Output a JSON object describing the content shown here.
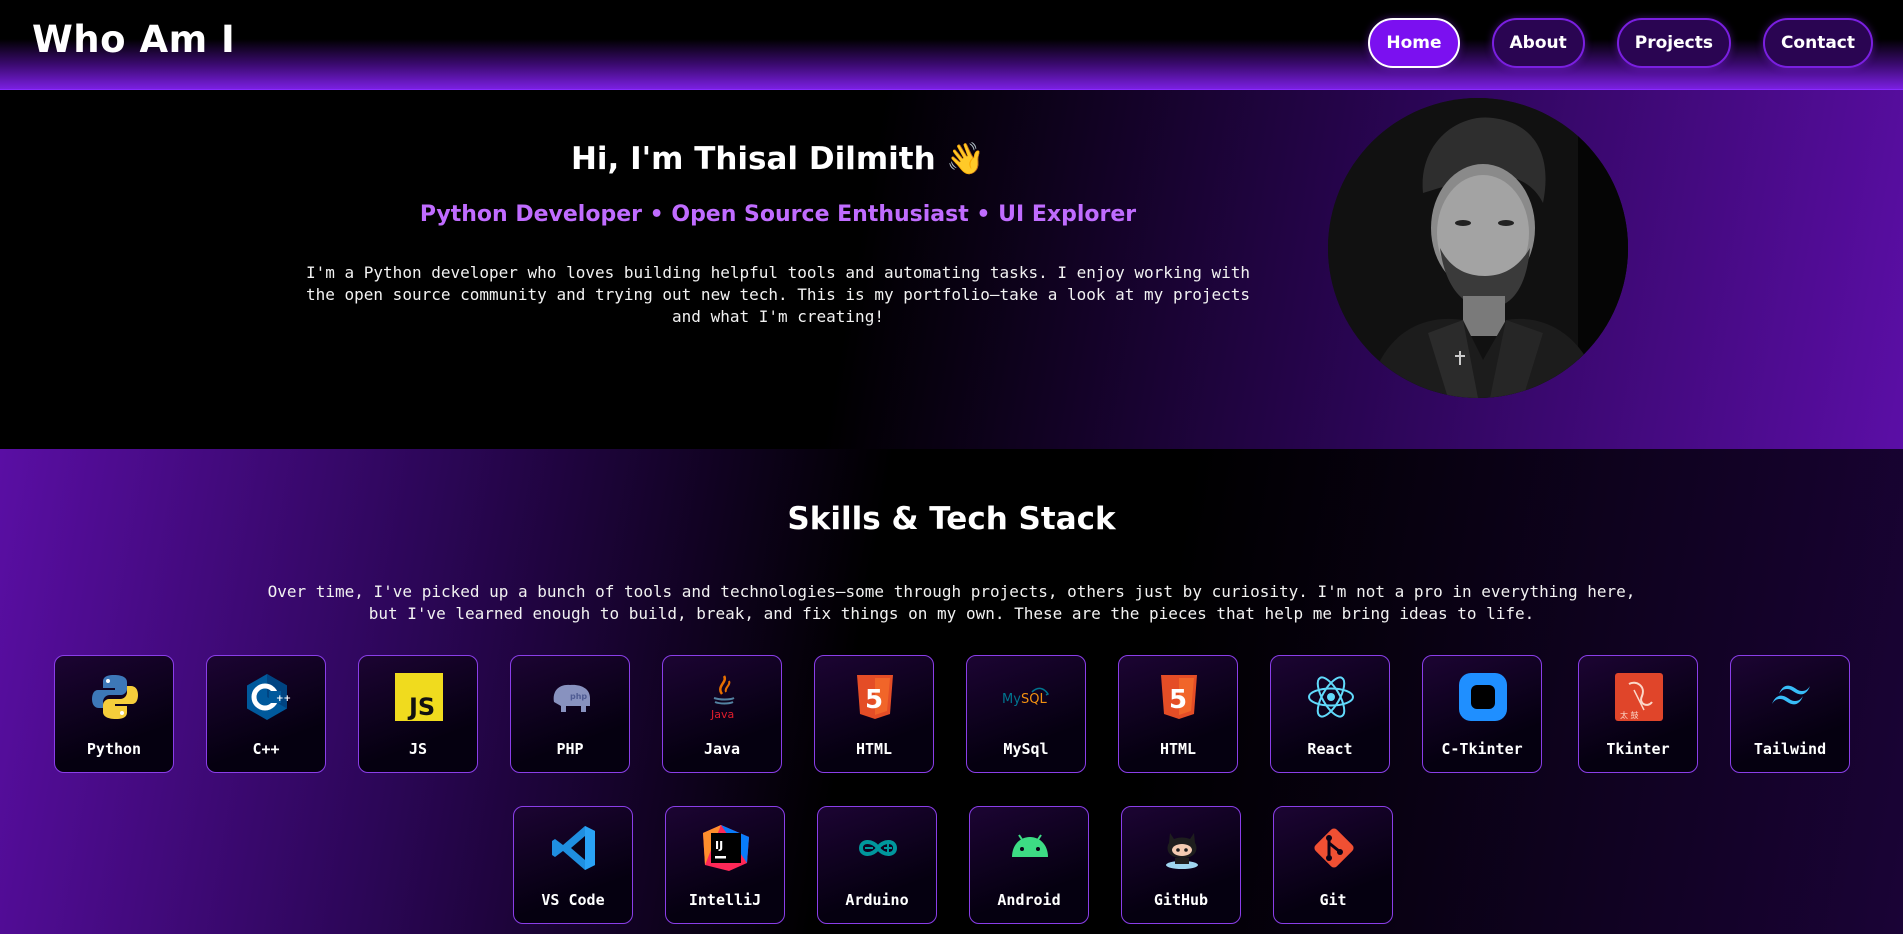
{
  "header": {
    "logo": "Who Am I",
    "nav": [
      {
        "label": "Home",
        "active": true
      },
      {
        "label": "About",
        "active": false
      },
      {
        "label": "Projects",
        "active": false
      },
      {
        "label": "Contact",
        "active": false
      }
    ]
  },
  "hero": {
    "title": "Hi, I'm Thisal Dilmith 👋",
    "subtitle": "Python Developer • Open Source Enthusiast • UI Explorer",
    "text": "I'm a Python developer who loves building helpful tools and automating tasks. I enjoy working with the open source community and trying out new tech. This is my portfolio—take a look at my projects and what I'm creating!"
  },
  "skills": {
    "title": "Skills & Tech Stack",
    "text": "Over time, I've picked up a bunch of tools and technologies—some through projects, others just by curiosity. I'm not a pro in everything here, but I've learned enough to build, break, and fix things on my own. These are the pieces that help me bring ideas to life.",
    "items": [
      {
        "label": "Python",
        "icon": "python-icon"
      },
      {
        "label": "C++",
        "icon": "cpp-icon"
      },
      {
        "label": "JS",
        "icon": "js-icon"
      },
      {
        "label": "PHP",
        "icon": "php-icon"
      },
      {
        "label": "Java",
        "icon": "java-icon"
      },
      {
        "label": "HTML",
        "icon": "html5-icon"
      },
      {
        "label": "MySql",
        "icon": "mysql-icon"
      },
      {
        "label": "HTML",
        "icon": "html5-icon"
      },
      {
        "label": "React",
        "icon": "react-icon"
      },
      {
        "label": "C-Tkinter",
        "icon": "ctkinter-icon"
      },
      {
        "label": "Tkinter",
        "icon": "tkinter-icon"
      },
      {
        "label": "Tailwind",
        "icon": "tailwind-icon"
      },
      {
        "label": "VS Code",
        "icon": "vscode-icon"
      },
      {
        "label": "IntelliJ",
        "icon": "intellij-icon"
      },
      {
        "label": "Arduino",
        "icon": "arduino-icon"
      },
      {
        "label": "Android",
        "icon": "android-icon"
      },
      {
        "label": "GitHub",
        "icon": "github-icon"
      },
      {
        "label": "Git",
        "icon": "git-icon"
      }
    ]
  }
}
